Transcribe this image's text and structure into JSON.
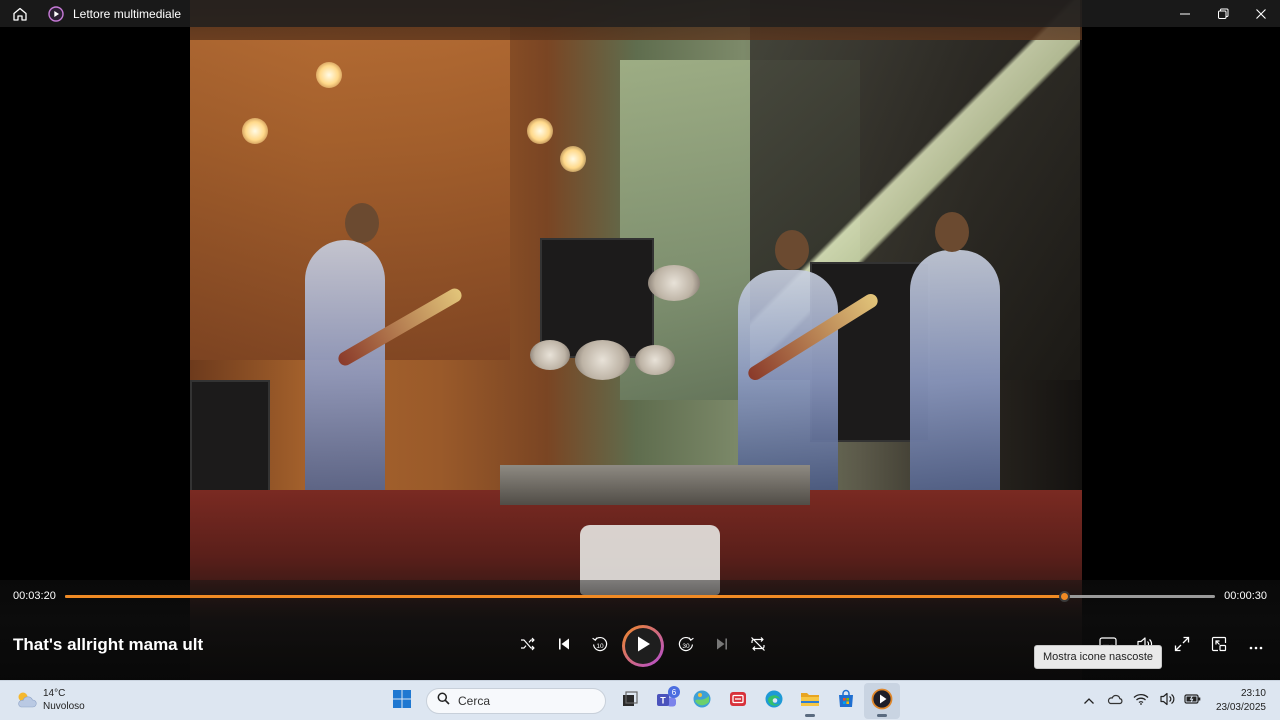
{
  "window": {
    "title": "Lettore multimediale"
  },
  "player": {
    "current_time": "00:03:20",
    "remaining_time": "00:00:30",
    "progress_percent": 86.9,
    "media_title": "That's allright mama ult",
    "tooltip": "Mostra icone nascoste",
    "accent_color": "#f08a24"
  },
  "transport_icons": [
    "shuffle-icon",
    "previous-icon",
    "rewind-10-icon",
    "play-icon",
    "forward-30-icon",
    "next-icon",
    "repeat-off-icon"
  ],
  "right_tool_icons": [
    "subtitles-icon",
    "volume-icon",
    "fullscreen-icon",
    "miniplayer-icon",
    "more-icon"
  ],
  "taskbar": {
    "weather": {
      "temp": "14°C",
      "condition": "Nuvoloso"
    },
    "search_placeholder": "Cerca",
    "teams_badge": "6",
    "apps": [
      "start-icon",
      "search",
      "task-view-icon",
      "teams-icon",
      "photos-icon",
      "news-icon",
      "edge-icon",
      "file-explorer-icon",
      "store-icon",
      "media-player-icon"
    ],
    "clock": {
      "time": "23:10",
      "date": "23/03/2025"
    }
  }
}
